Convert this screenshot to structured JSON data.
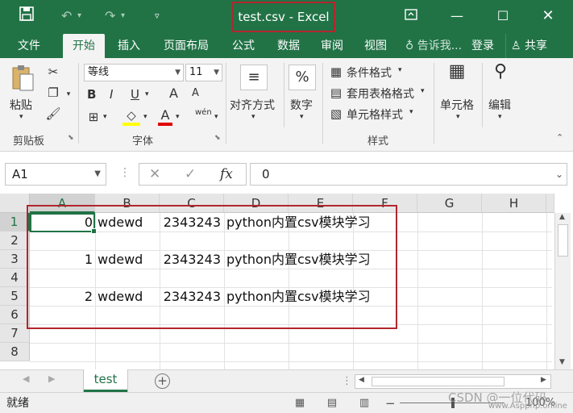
{
  "window": {
    "title": "test.csv - Excel",
    "save_icon": "save-icon",
    "undo_icon": "undo-icon",
    "redo_icon": "redo-icon"
  },
  "menu": {
    "tabs": [
      "文件",
      "开始",
      "插入",
      "页面布局",
      "公式",
      "数据",
      "审阅",
      "视图"
    ],
    "active_tab": "开始",
    "tell_me": "告诉我...",
    "login": "登录",
    "share": "共享"
  },
  "ribbon": {
    "clipboard": {
      "paste": "粘贴",
      "group": "剪贴板"
    },
    "font": {
      "name": "等线",
      "size": "11",
      "group": "字体",
      "bold": "B",
      "italic": "I",
      "underline": "U",
      "grow": "A",
      "shrink": "A",
      "font_color": "A",
      "phonetic": "wén"
    },
    "alignment": {
      "label": "对齐方式"
    },
    "number": {
      "label": "数字",
      "symbol": "%"
    },
    "styles": {
      "conditional": "条件格式",
      "table": "套用表格格式",
      "cell_styles": "单元格样式",
      "group": "样式"
    },
    "cells": {
      "label": "单元格"
    },
    "editing": {
      "label": "编辑"
    }
  },
  "formula_bar": {
    "name_box": "A1",
    "value": "0",
    "cancel": "✕",
    "enter": "✓",
    "fx": "fx"
  },
  "grid": {
    "columns": [
      "A",
      "B",
      "C",
      "D",
      "E",
      "F",
      "G",
      "H"
    ],
    "rows": [
      "1",
      "2",
      "3",
      "4",
      "5",
      "6",
      "7",
      "8"
    ],
    "active_cell": "A1",
    "data_rows": [
      {
        "row": 1,
        "a": "0",
        "b": "wdewd",
        "c": "2343243",
        "d": "python内置csv模块学习"
      },
      {
        "row": 3,
        "a": "1",
        "b": "wdewd",
        "c": "2343243",
        "d": "python内置csv模块学习"
      },
      {
        "row": 5,
        "a": "2",
        "b": "wdewd",
        "c": "2343243",
        "d": "python内置csv模块学习"
      }
    ]
  },
  "sheets": {
    "tabs": [
      "test"
    ],
    "active": "test",
    "add": "+"
  },
  "status": {
    "ready": "就绪",
    "zoom": "100%",
    "zoom_minus": "−"
  },
  "watermark": {
    "text": "CSDN @一位代码",
    "sub": "www.Aspphp.online"
  }
}
